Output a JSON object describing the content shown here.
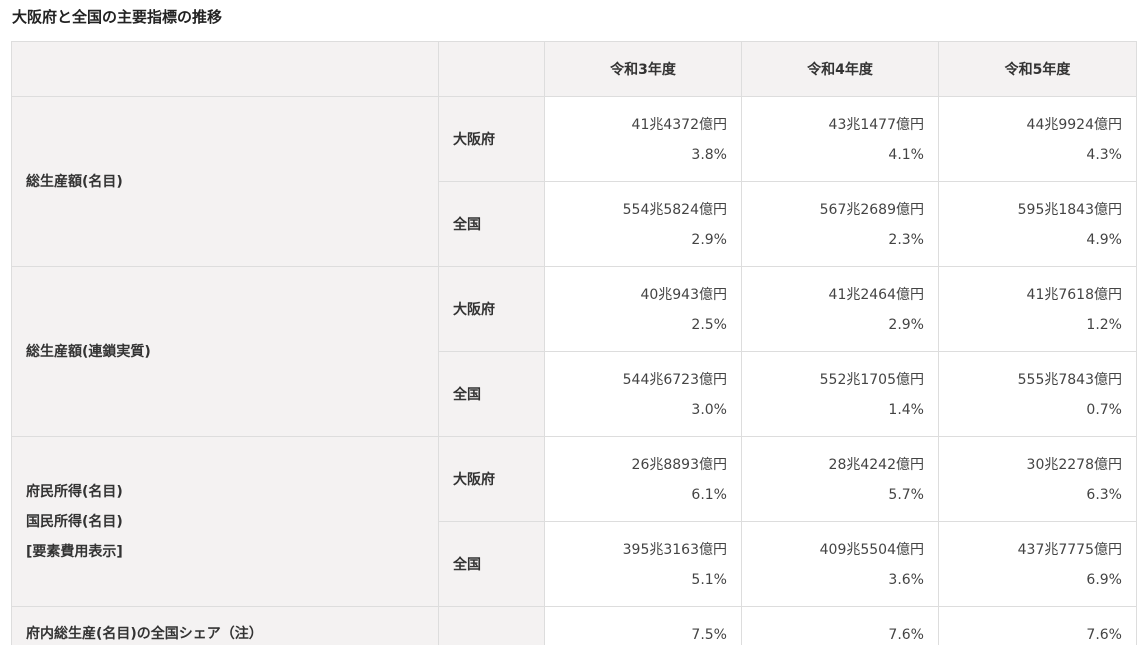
{
  "title": "大阪府と全国の主要指標の推移",
  "table": {
    "headers": [
      "令和3年度",
      "令和4年度",
      "令和5年度"
    ],
    "groups": [
      {
        "label_lines": [
          "総生産額(名目)"
        ],
        "rows": [
          {
            "region": "大阪府",
            "cells": [
              {
                "amount": "41兆4372億円",
                "rate": "3.8%"
              },
              {
                "amount": "43兆1477億円",
                "rate": "4.1%"
              },
              {
                "amount": "44兆9924億円",
                "rate": "4.3%"
              }
            ]
          },
          {
            "region": "全国",
            "cells": [
              {
                "amount": "554兆5824億円",
                "rate": "2.9%"
              },
              {
                "amount": "567兆2689億円",
                "rate": "2.3%"
              },
              {
                "amount": "595兆1843億円",
                "rate": "4.9%"
              }
            ]
          }
        ]
      },
      {
        "label_lines": [
          "総生産額(連鎖実質)"
        ],
        "rows": [
          {
            "region": "大阪府",
            "cells": [
              {
                "amount": "40兆943億円",
                "rate": "2.5%"
              },
              {
                "amount": "41兆2464億円",
                "rate": "2.9%"
              },
              {
                "amount": "41兆7618億円",
                "rate": "1.2%"
              }
            ]
          },
          {
            "region": "全国",
            "cells": [
              {
                "amount": "544兆6723億円",
                "rate": "3.0%"
              },
              {
                "amount": "552兆1705億円",
                "rate": "1.4%"
              },
              {
                "amount": "555兆7843億円",
                "rate": "0.7%"
              }
            ]
          }
        ]
      },
      {
        "label_lines": [
          "府民所得(名目)",
          "国民所得(名目)",
          "[要素費用表示]"
        ],
        "rows": [
          {
            "region": "大阪府",
            "cells": [
              {
                "amount": "26兆8893億円",
                "rate": "6.1%"
              },
              {
                "amount": "28兆4242億円",
                "rate": "5.7%"
              },
              {
                "amount": "30兆2278億円",
                "rate": "6.3%"
              }
            ]
          },
          {
            "region": "全国",
            "cells": [
              {
                "amount": "395兆3163億円",
                "rate": "5.1%"
              },
              {
                "amount": "409兆5504億円",
                "rate": "3.6%"
              },
              {
                "amount": "437兆7775億円",
                "rate": "6.9%"
              }
            ]
          }
        ]
      }
    ],
    "share_row": {
      "label": "府内総生産(名目)の全国シェア（注）",
      "values": [
        "7.5%",
        "7.6%",
        "7.6%"
      ]
    }
  }
}
